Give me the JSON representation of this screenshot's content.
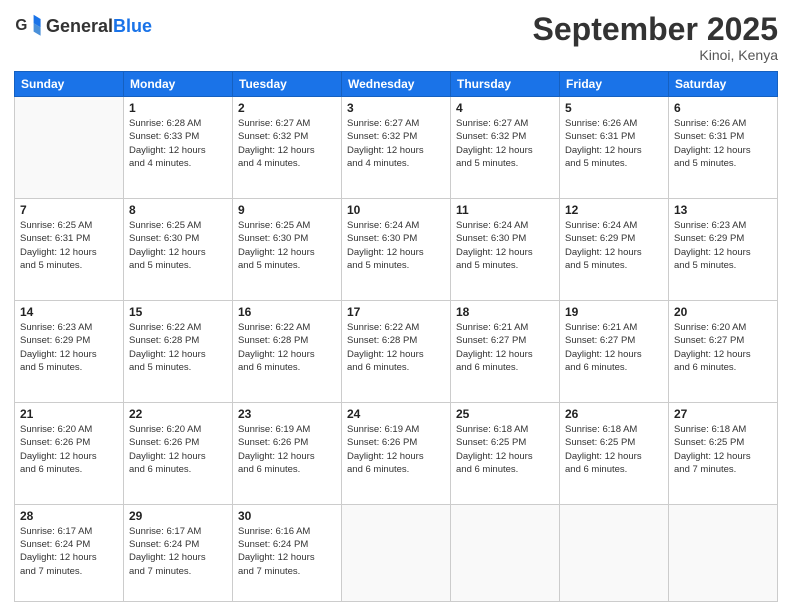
{
  "header": {
    "logo": {
      "general": "General",
      "blue": "Blue"
    },
    "title": "September 2025",
    "subtitle": "Kinoi, Kenya"
  },
  "days_of_week": [
    "Sunday",
    "Monday",
    "Tuesday",
    "Wednesday",
    "Thursday",
    "Friday",
    "Saturday"
  ],
  "weeks": [
    [
      {
        "day": "",
        "info": ""
      },
      {
        "day": "1",
        "info": "Sunrise: 6:28 AM\nSunset: 6:33 PM\nDaylight: 12 hours\nand 4 minutes."
      },
      {
        "day": "2",
        "info": "Sunrise: 6:27 AM\nSunset: 6:32 PM\nDaylight: 12 hours\nand 4 minutes."
      },
      {
        "day": "3",
        "info": "Sunrise: 6:27 AM\nSunset: 6:32 PM\nDaylight: 12 hours\nand 4 minutes."
      },
      {
        "day": "4",
        "info": "Sunrise: 6:27 AM\nSunset: 6:32 PM\nDaylight: 12 hours\nand 5 minutes."
      },
      {
        "day": "5",
        "info": "Sunrise: 6:26 AM\nSunset: 6:31 PM\nDaylight: 12 hours\nand 5 minutes."
      },
      {
        "day": "6",
        "info": "Sunrise: 6:26 AM\nSunset: 6:31 PM\nDaylight: 12 hours\nand 5 minutes."
      }
    ],
    [
      {
        "day": "7",
        "info": "Sunrise: 6:25 AM\nSunset: 6:31 PM\nDaylight: 12 hours\nand 5 minutes."
      },
      {
        "day": "8",
        "info": "Sunrise: 6:25 AM\nSunset: 6:30 PM\nDaylight: 12 hours\nand 5 minutes."
      },
      {
        "day": "9",
        "info": "Sunrise: 6:25 AM\nSunset: 6:30 PM\nDaylight: 12 hours\nand 5 minutes."
      },
      {
        "day": "10",
        "info": "Sunrise: 6:24 AM\nSunset: 6:30 PM\nDaylight: 12 hours\nand 5 minutes."
      },
      {
        "day": "11",
        "info": "Sunrise: 6:24 AM\nSunset: 6:30 PM\nDaylight: 12 hours\nand 5 minutes."
      },
      {
        "day": "12",
        "info": "Sunrise: 6:24 AM\nSunset: 6:29 PM\nDaylight: 12 hours\nand 5 minutes."
      },
      {
        "day": "13",
        "info": "Sunrise: 6:23 AM\nSunset: 6:29 PM\nDaylight: 12 hours\nand 5 minutes."
      }
    ],
    [
      {
        "day": "14",
        "info": "Sunrise: 6:23 AM\nSunset: 6:29 PM\nDaylight: 12 hours\nand 5 minutes."
      },
      {
        "day": "15",
        "info": "Sunrise: 6:22 AM\nSunset: 6:28 PM\nDaylight: 12 hours\nand 5 minutes."
      },
      {
        "day": "16",
        "info": "Sunrise: 6:22 AM\nSunset: 6:28 PM\nDaylight: 12 hours\nand 6 minutes."
      },
      {
        "day": "17",
        "info": "Sunrise: 6:22 AM\nSunset: 6:28 PM\nDaylight: 12 hours\nand 6 minutes."
      },
      {
        "day": "18",
        "info": "Sunrise: 6:21 AM\nSunset: 6:27 PM\nDaylight: 12 hours\nand 6 minutes."
      },
      {
        "day": "19",
        "info": "Sunrise: 6:21 AM\nSunset: 6:27 PM\nDaylight: 12 hours\nand 6 minutes."
      },
      {
        "day": "20",
        "info": "Sunrise: 6:20 AM\nSunset: 6:27 PM\nDaylight: 12 hours\nand 6 minutes."
      }
    ],
    [
      {
        "day": "21",
        "info": "Sunrise: 6:20 AM\nSunset: 6:26 PM\nDaylight: 12 hours\nand 6 minutes."
      },
      {
        "day": "22",
        "info": "Sunrise: 6:20 AM\nSunset: 6:26 PM\nDaylight: 12 hours\nand 6 minutes."
      },
      {
        "day": "23",
        "info": "Sunrise: 6:19 AM\nSunset: 6:26 PM\nDaylight: 12 hours\nand 6 minutes."
      },
      {
        "day": "24",
        "info": "Sunrise: 6:19 AM\nSunset: 6:26 PM\nDaylight: 12 hours\nand 6 minutes."
      },
      {
        "day": "25",
        "info": "Sunrise: 6:18 AM\nSunset: 6:25 PM\nDaylight: 12 hours\nand 6 minutes."
      },
      {
        "day": "26",
        "info": "Sunrise: 6:18 AM\nSunset: 6:25 PM\nDaylight: 12 hours\nand 6 minutes."
      },
      {
        "day": "27",
        "info": "Sunrise: 6:18 AM\nSunset: 6:25 PM\nDaylight: 12 hours\nand 7 minutes."
      }
    ],
    [
      {
        "day": "28",
        "info": "Sunrise: 6:17 AM\nSunset: 6:24 PM\nDaylight: 12 hours\nand 7 minutes."
      },
      {
        "day": "29",
        "info": "Sunrise: 6:17 AM\nSunset: 6:24 PM\nDaylight: 12 hours\nand 7 minutes."
      },
      {
        "day": "30",
        "info": "Sunrise: 6:16 AM\nSunset: 6:24 PM\nDaylight: 12 hours\nand 7 minutes."
      },
      {
        "day": "",
        "info": ""
      },
      {
        "day": "",
        "info": ""
      },
      {
        "day": "",
        "info": ""
      },
      {
        "day": "",
        "info": ""
      }
    ]
  ]
}
